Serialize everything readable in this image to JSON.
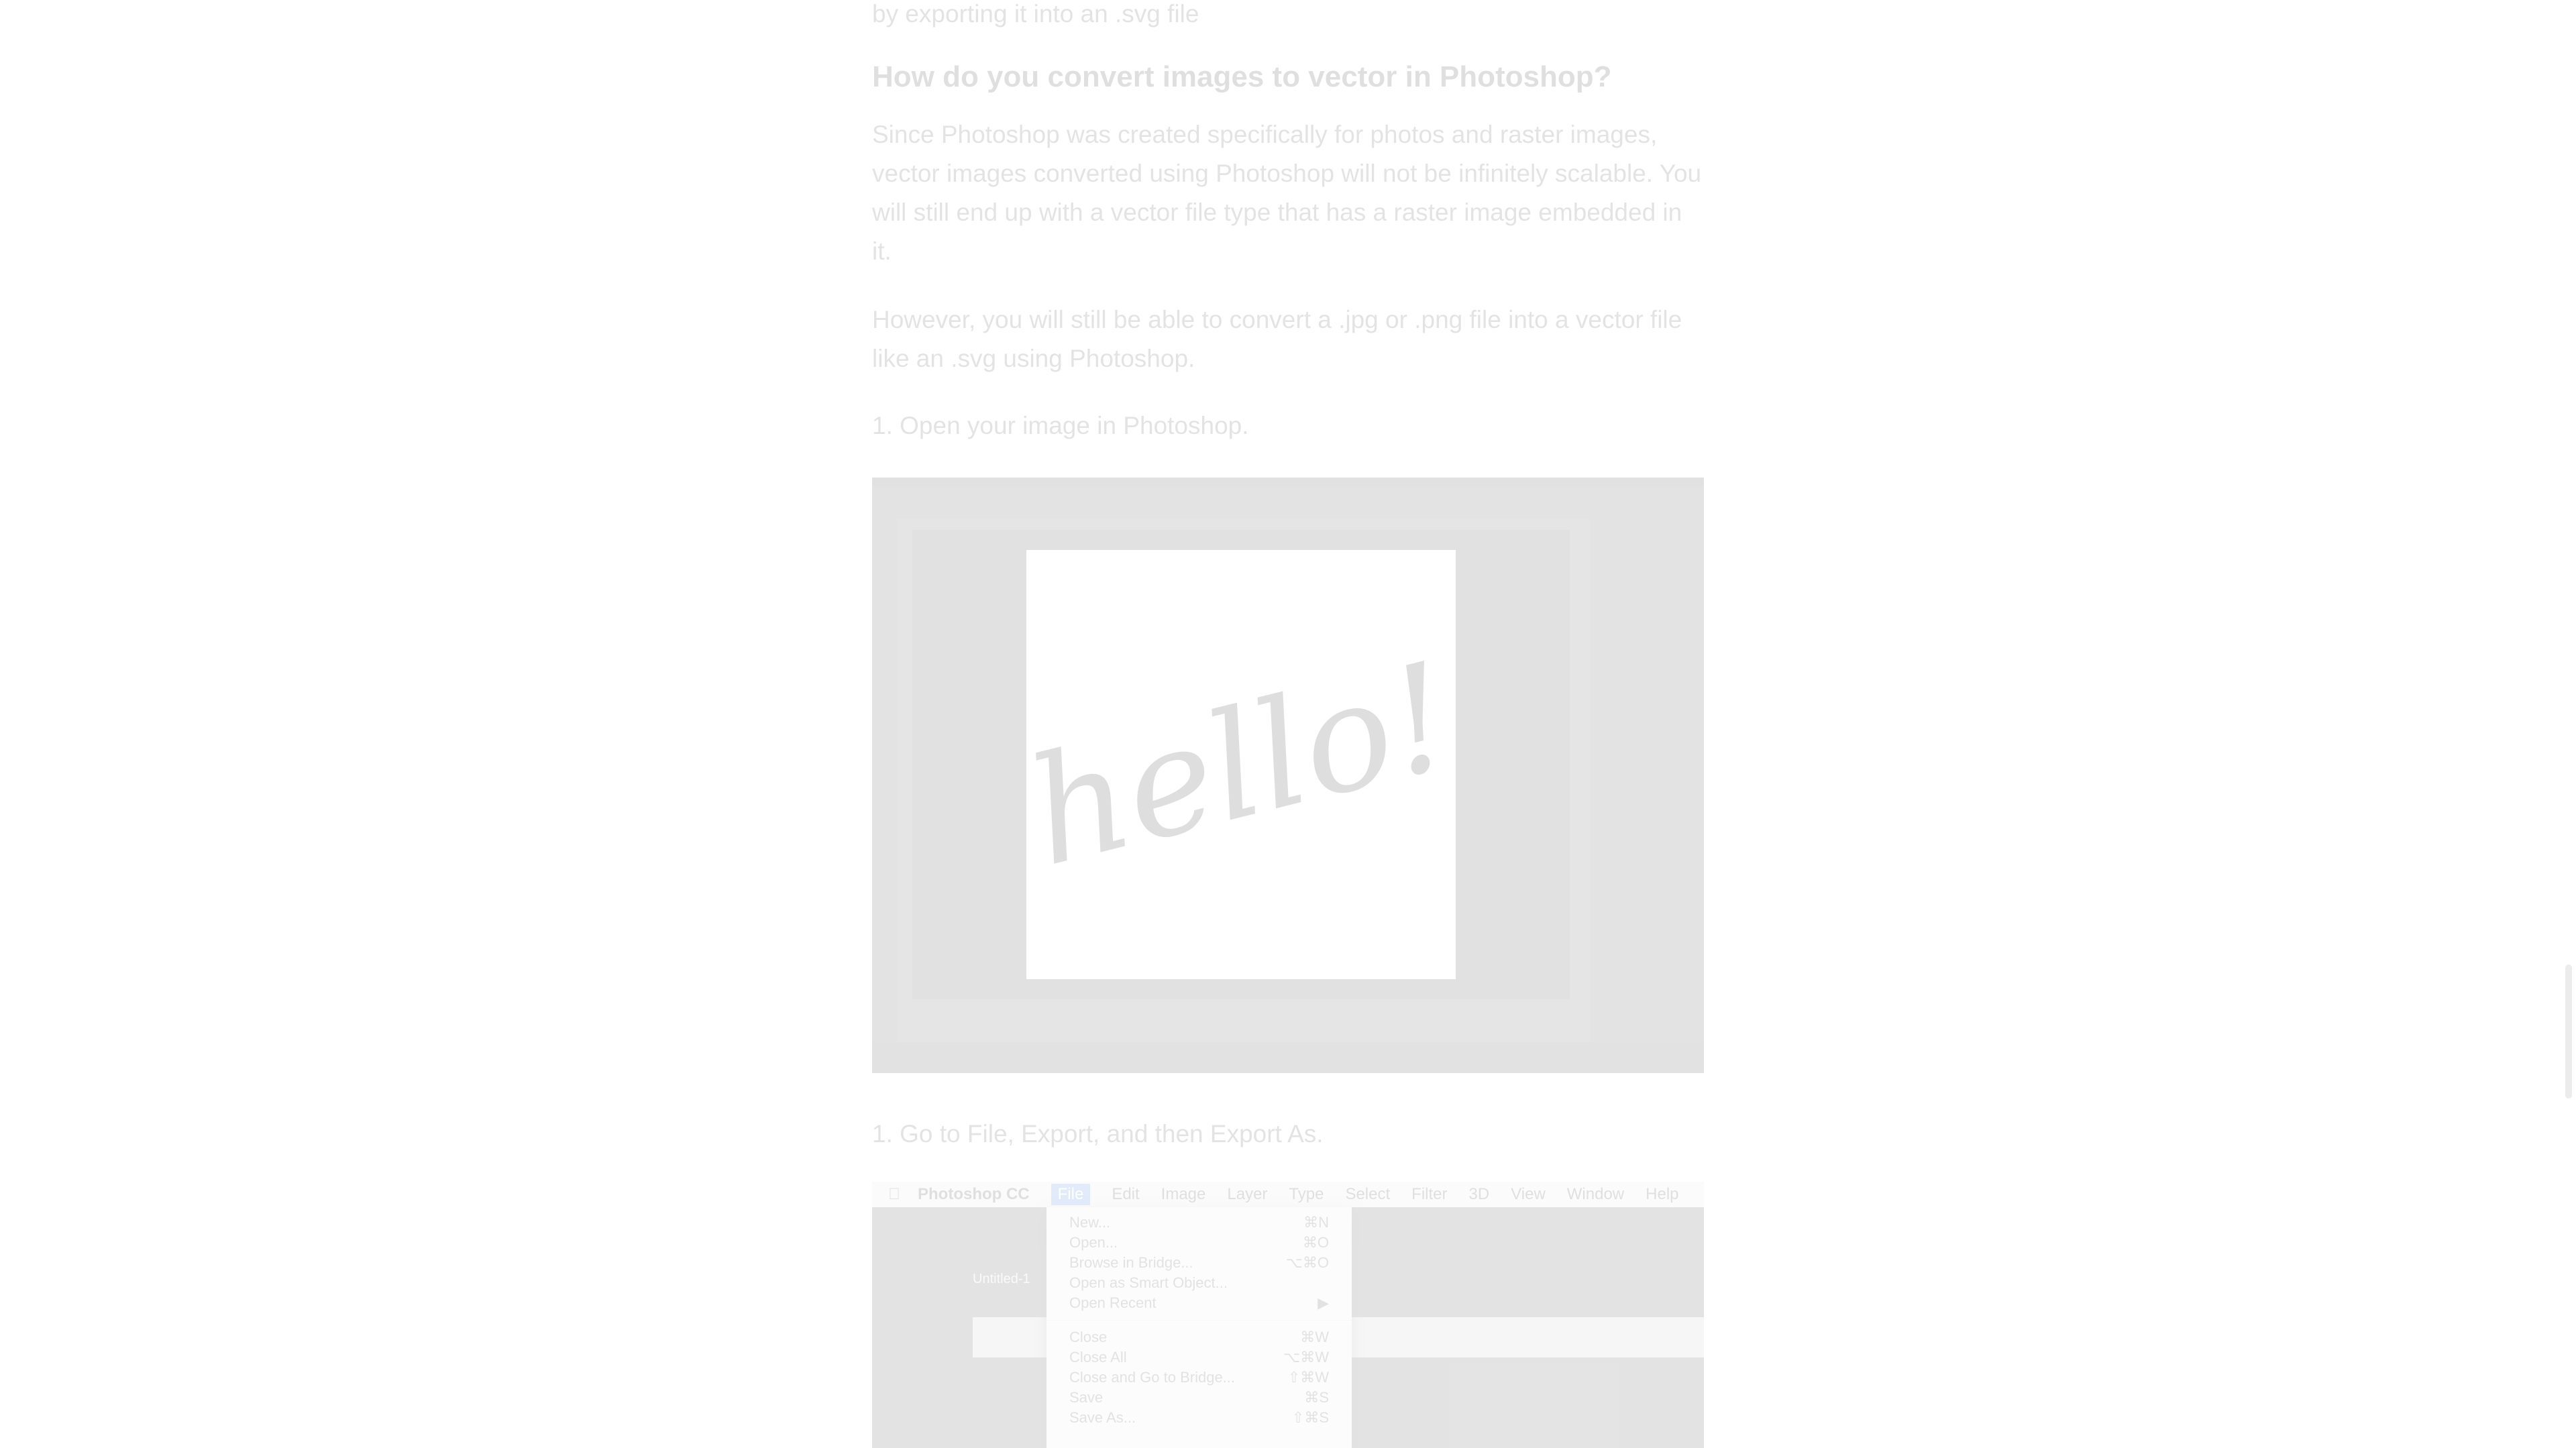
{
  "article": {
    "intro_tail": "by exporting it into an .svg file",
    "heading": "How do you convert images to vector in Photoshop?",
    "para1_lines": [
      "Since Photoshop was created specifically for photos and raster images,",
      "vector images converted using Photoshop will not be infinitely scalable. You",
      "will still end up with a vector file type that has a raster image embedded in",
      "it."
    ],
    "para2_lines": [
      "However, you will still be able to convert a .jpg or .png file into a vector file",
      "like an .svg using Photoshop."
    ],
    "step1": "1. Open your image in Photoshop.",
    "step2": "1. Go to File, Export, and then Export As."
  },
  "screenshot1": {
    "canvas_text": "hello!"
  },
  "screenshot2": {
    "menubar": [
      "Photoshop CC",
      "File",
      "Edit",
      "Image",
      "Layer",
      "Type",
      "Select",
      "Filter",
      "3D",
      "View",
      "Window",
      "Help"
    ],
    "file_menu": [
      {
        "label": "New...",
        "shortcut": "⌘N"
      },
      {
        "label": "Open...",
        "shortcut": "⌘O"
      },
      {
        "label": "Browse in Bridge...",
        "shortcut": "⌥⌘O"
      },
      {
        "label": "Open as Smart Object...",
        "shortcut": ""
      },
      {
        "label": "Open Recent",
        "shortcut": "▶"
      },
      {
        "label": "Close",
        "shortcut": "⌘W"
      },
      {
        "label": "Close All",
        "shortcut": "⌥⌘W"
      },
      {
        "label": "Close and Go to Bridge...",
        "shortcut": "⇧⌘W"
      },
      {
        "label": "Save",
        "shortcut": "⌘S"
      },
      {
        "label": "Save As...",
        "shortcut": "⇧⌘S"
      }
    ],
    "doc_tab": "Untitled-1"
  },
  "colors": {
    "text": "#3c3c3c",
    "heading": "#222222",
    "overlay": "rgba(255,255,255,0.86)"
  }
}
